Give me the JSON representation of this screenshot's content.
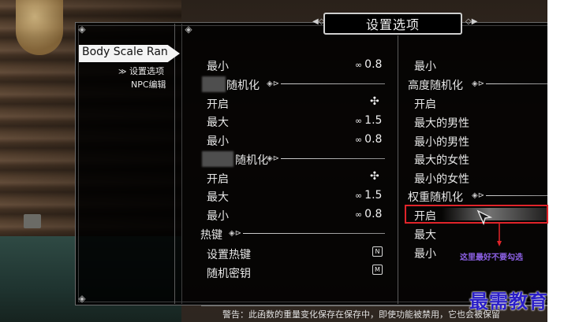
{
  "header": {
    "title": "设置选项"
  },
  "sidebar": {
    "mod_name": "Body Scale Ran",
    "items": [
      {
        "label": "设置选项",
        "icon": "selected-diamond-icon"
      },
      {
        "label": "NPC编辑"
      }
    ]
  },
  "left_column": [
    {
      "label": "最小",
      "value": "0.8"
    },
    {
      "label": "随机化",
      "kind": "header"
    },
    {
      "label": "开启",
      "value_icon": "toggle-off-icon"
    },
    {
      "label": "最大",
      "value": "1.5"
    },
    {
      "label": "最小",
      "value": "0.8"
    },
    {
      "label": "随机化",
      "kind": "header"
    },
    {
      "label": "开启",
      "value_icon": "toggle-off-icon"
    },
    {
      "label": "最大",
      "value": "1.5"
    },
    {
      "label": "最小",
      "value": "0.8"
    },
    {
      "label": "热键",
      "kind": "header"
    },
    {
      "label": "设置热键",
      "key": "N"
    },
    {
      "label": "随机密钥",
      "key": "M"
    }
  ],
  "right_column": [
    {
      "label": "最小"
    },
    {
      "label": "高度随机化",
      "kind": "header"
    },
    {
      "label": "开启"
    },
    {
      "label": "最大的男性"
    },
    {
      "label": "最小的男性"
    },
    {
      "label": "最大的女性"
    },
    {
      "label": "最小的女性"
    },
    {
      "label": "权重随机化",
      "kind": "header"
    },
    {
      "label": "开启",
      "highlighted": true
    },
    {
      "label": "最大"
    },
    {
      "label": "最小"
    }
  ],
  "annotation": "这里最好不要勾选",
  "warning": "警告：此函数的重量变化保存在保存中，即使功能被禁用，它也会被保留",
  "watermark": "最需教育",
  "colors": {
    "highlight_border": "#e0242a",
    "annotation": "#8e62e8",
    "watermark": "#2b1fc8"
  }
}
